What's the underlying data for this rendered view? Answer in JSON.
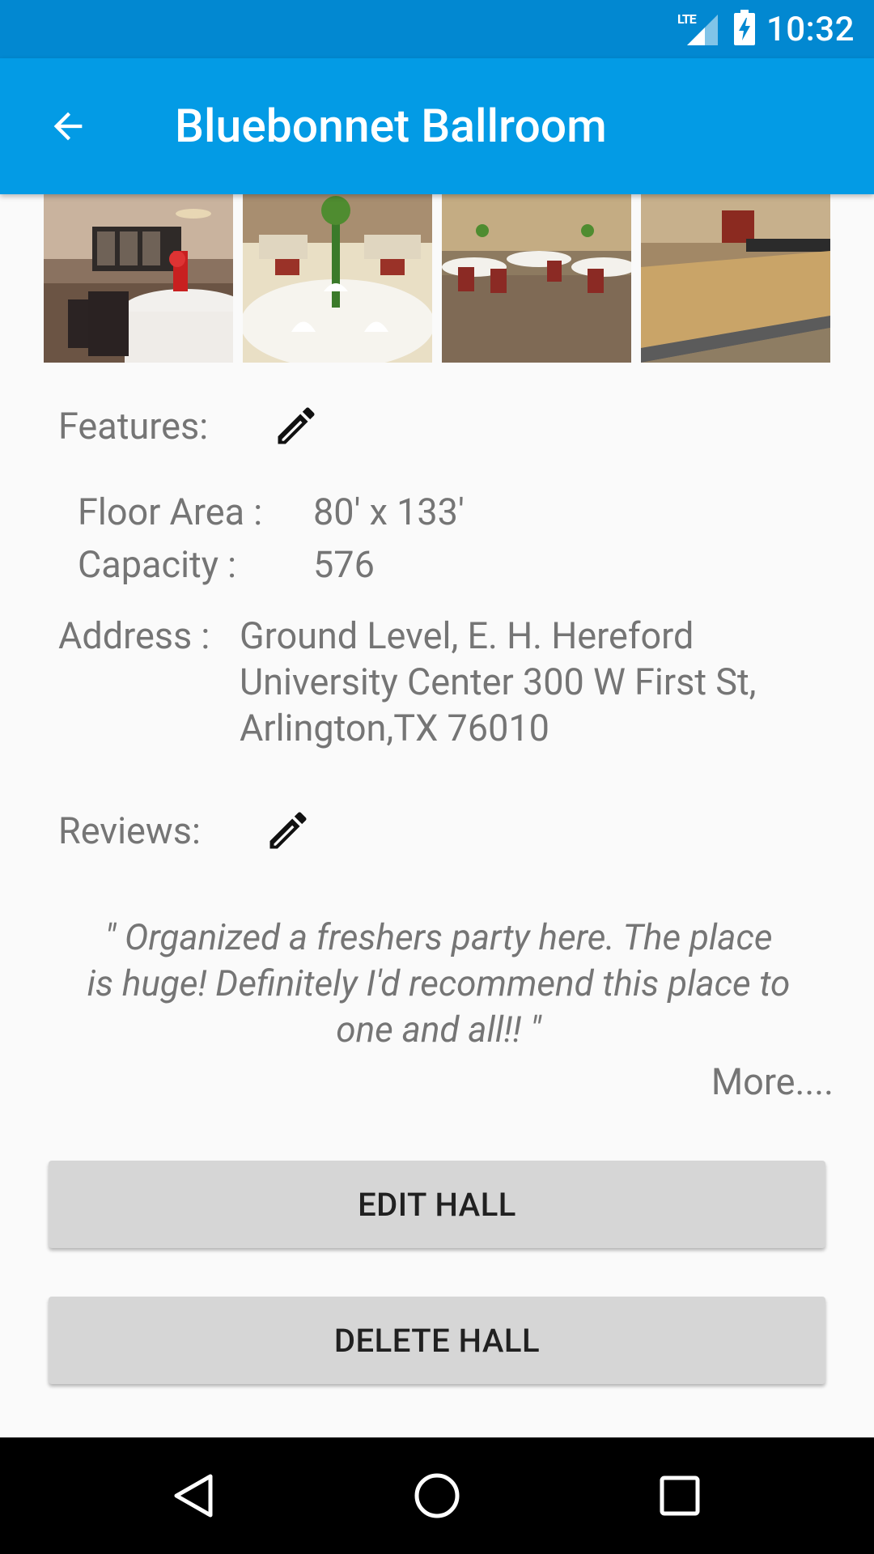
{
  "status": {
    "network": "LTE",
    "time": "10:32"
  },
  "appbar": {
    "title": "Bluebonnet Ballroom",
    "back_icon": "arrow-back-icon"
  },
  "photos": [
    {
      "name": "photo-ballroom-1"
    },
    {
      "name": "photo-ballroom-2"
    },
    {
      "name": "photo-ballroom-3"
    },
    {
      "name": "photo-ballroom-4"
    }
  ],
  "features": {
    "label": "Features:",
    "edit_icon": "pencil-icon",
    "floor_area_label": "Floor Area :",
    "floor_area_value": "80' x 133'",
    "capacity_label": "Capacity :",
    "capacity_value": "576"
  },
  "address": {
    "label": "Address :",
    "line1": "Ground Level, E. H. Hereford",
    "line2": "University Center 300 W First St,",
    "line3": "Arlington,TX 76010"
  },
  "reviews": {
    "label": "Reviews:",
    "edit_icon": "pencil-icon",
    "line1": "\" Organized a freshers party here. The place",
    "line2": "is huge! Definitely I'd recommend this place to",
    "line3": "one and all!!  \"",
    "more": "More...."
  },
  "buttons": {
    "edit": "EDIT HALL",
    "delete": "DELETE HALL"
  },
  "navbar": {
    "back": "nav-back-icon",
    "home": "nav-home-icon",
    "recents": "nav-recents-icon"
  },
  "colors": {
    "status_bar": "#0288d1",
    "app_bar": "#039be5",
    "background": "#fafafa",
    "button": "#d6d6d6",
    "text_secondary": "#757575"
  }
}
